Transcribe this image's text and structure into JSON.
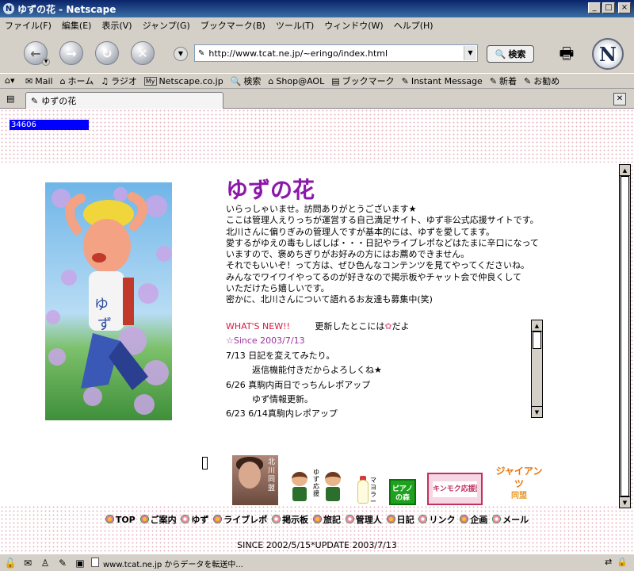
{
  "window": {
    "title": "ゆずの花 - Netscape"
  },
  "menu": [
    "ファイル(F)",
    "編集(E)",
    "表示(V)",
    "ジャンプ(G)",
    "ブックマーク(B)",
    "ツール(T)",
    "ウィンドウ(W)",
    "ヘルプ(H)"
  ],
  "url": "http://www.tcat.ne.jp/~eringo/index.html",
  "search_label": "検索",
  "personal_toolbar": [
    {
      "label": "Mail",
      "icon": "mail-icon"
    },
    {
      "label": "ホーム",
      "icon": "home-icon"
    },
    {
      "label": "ラジオ",
      "icon": "radio-icon"
    },
    {
      "label": "Netscape.co.jp",
      "icon": "my-icon"
    },
    {
      "label": "検索",
      "icon": "search-icon"
    },
    {
      "label": "Shop@AOL",
      "icon": "shop-icon"
    },
    {
      "label": "ブックマーク",
      "icon": "bookmark-icon"
    },
    {
      "label": "Instant Message",
      "icon": "bookmark-icon"
    },
    {
      "label": "新着",
      "icon": "bookmark-icon"
    },
    {
      "label": "お勧め",
      "icon": "bookmark-icon"
    }
  ],
  "tab": {
    "title": "ゆずの花"
  },
  "page": {
    "counter": "34606",
    "title": "ゆずの花",
    "intro": [
      "いらっしゃいませ。訪問ありがとうございます★",
      "ここは管理人えりっちが運営する自己満足サイト、ゆず非公式応援サイトです。",
      "北川さんに偏りぎみの管理人ですが基本的には、ゆずを愛してます。",
      "愛するがゆえの毒もしばしば・・・日記やライブレポなどはたまに辛口になって",
      "いますので、褒めちぎりがお好みの方にはお薦めできません。",
      "それでもいいぞ！って方は、ぜひ色んなコンテンツを見てやってくださいね。",
      "みんなでワイワイやってるのが好きなので掲示板やチャット会で仲良くして",
      "いただけたら嬉しいです。",
      "密かに、北川さんについて語れるお友達も募集中(笑)"
    ],
    "news": {
      "heading": "WHAT'S NEW!!",
      "heading_note": "更新したとこには",
      "heading_note_after": "だよ",
      "since": "☆Since  2003/7/13",
      "items": [
        {
          "text": "7/13 日記を変えてみたり。",
          "indent": false
        },
        {
          "text": "返信機能付きだからよろしくね★",
          "indent": true
        },
        {
          "text": "6/26 真駒内両日でっちんレポアップ",
          "indent": false
        },
        {
          "text": "ゆず情報更新。",
          "indent": true
        },
        {
          "text": "6/23 6/14真駒内レポアップ",
          "indent": false
        }
      ]
    },
    "banners": {
      "kitagawa": "北川同盟",
      "yuzu_kids": "ゆず応援",
      "mayo": "マヨラー",
      "piano": "ピアノの森",
      "kinmoku": "キンモク応援団",
      "giants": "ジャイアンツ",
      "giants_sub": "同盟"
    },
    "footer_nav": [
      "TOP",
      "ご案内",
      "ゆず",
      "ライブレポ",
      "掲示板",
      "旅記",
      "管理人",
      "日記",
      "リンク",
      "企画",
      "メール"
    ],
    "since_update": "SINCE 2002/5/15*UPDATE 2003/7/13"
  },
  "status": {
    "text": "www.tcat.ne.jp からデータを転送中..."
  },
  "colors": {
    "title_purple": "#8b18a8",
    "counter_blue": "#0000ff",
    "news_red": "#d9193b",
    "dot_pink": "#e9b8c5"
  }
}
